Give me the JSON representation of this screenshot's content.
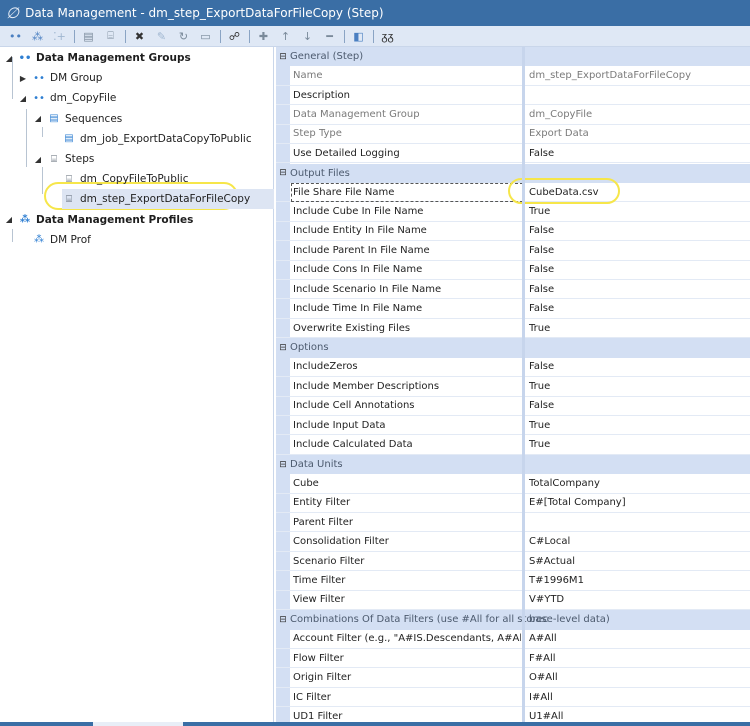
{
  "window": {
    "title": "Data Management - dm_step_ExportDataForFileCopy (Step)",
    "logo_glyph": "∅"
  },
  "toolbar": {
    "buttons": [
      {
        "name": "groups-icon",
        "glyph": "••"
      },
      {
        "name": "profiles-icon",
        "glyph": "⁂"
      },
      {
        "name": "add-group-icon",
        "glyph": "⁚+"
      },
      {
        "name": "sequence-icon",
        "glyph": "▤"
      },
      {
        "name": "step-icon",
        "glyph": "⌸"
      },
      {
        "name": "delete-icon",
        "glyph": "✖"
      },
      {
        "name": "edit-icon",
        "glyph": "✎"
      },
      {
        "name": "refresh-icon",
        "glyph": "↻"
      },
      {
        "name": "save-icon",
        "glyph": "▭"
      },
      {
        "name": "search-icon",
        "glyph": "☍"
      },
      {
        "name": "add-icon",
        "glyph": "✚"
      },
      {
        "name": "move-up-icon",
        "glyph": "↑"
      },
      {
        "name": "move-down-icon",
        "glyph": "↓"
      },
      {
        "name": "remove-icon",
        "glyph": "━"
      },
      {
        "name": "open-icon",
        "glyph": "◧"
      },
      {
        "name": "view-icon",
        "glyph": "ᵹᵹ"
      }
    ]
  },
  "tree": {
    "items": [
      {
        "label": "Data Management Groups",
        "icon": "••",
        "expander": "◢",
        "bold": true
      },
      {
        "label": "DM Group",
        "icon": "••",
        "expander": "▶",
        "bold": false
      },
      {
        "label": "dm_CopyFile",
        "icon": "••",
        "expander": "◢",
        "bold": false
      },
      {
        "label": "Sequences",
        "icon": "▤",
        "expander": "◢",
        "bold": false
      },
      {
        "label": "dm_job_ExportDataCopyToPublic",
        "icon": "▤",
        "expander": "",
        "bold": false
      },
      {
        "label": "Steps",
        "icon": "⌸",
        "expander": "◢",
        "bold": false
      },
      {
        "label": "dm_CopyFileToPublic",
        "icon": "⌸",
        "expander": "",
        "bold": false
      },
      {
        "label": "dm_step_ExportDataForFileCopy",
        "icon": "⌸",
        "expander": "",
        "bold": false,
        "selected": true
      },
      {
        "label": "Data Management Profiles",
        "icon": "⁂",
        "expander": "◢",
        "bold": true
      },
      {
        "label": "DM Prof",
        "icon": "⁂",
        "expander": "",
        "bold": false
      }
    ]
  },
  "properties": {
    "collapse_glyph": "⊟",
    "categories": [
      {
        "label": "General (Step)",
        "rows": [
          {
            "label": "Name",
            "value": "dm_step_ExportDataForFileCopy",
            "readonly": true
          },
          {
            "label": "Description",
            "value": "",
            "readonly": false
          },
          {
            "label": "Data Management Group",
            "value": "dm_CopyFile",
            "readonly": true
          },
          {
            "label": "Step Type",
            "value": "Export Data",
            "readonly": true
          },
          {
            "label": "Use Detailed Logging",
            "value": "False",
            "readonly": false
          }
        ]
      },
      {
        "label": "Output Files",
        "rows": [
          {
            "label": "File Share File Name",
            "value": "CubeData.csv",
            "readonly": false,
            "focused": true
          },
          {
            "label": "Include Cube In File Name",
            "value": "True",
            "readonly": false
          },
          {
            "label": "Include Entity In File Name",
            "value": "False",
            "readonly": false
          },
          {
            "label": "Include Parent In File Name",
            "value": "False",
            "readonly": false
          },
          {
            "label": "Include Cons In File Name",
            "value": "False",
            "readonly": false
          },
          {
            "label": "Include Scenario In File Name",
            "value": "False",
            "readonly": false
          },
          {
            "label": "Include Time In File Name",
            "value": "False",
            "readonly": false
          },
          {
            "label": "Overwrite Existing Files",
            "value": "True",
            "readonly": false
          }
        ]
      },
      {
        "label": "Options",
        "rows": [
          {
            "label": "IncludeZeros",
            "value": "False",
            "readonly": false
          },
          {
            "label": "Include Member Descriptions",
            "value": "True",
            "readonly": false
          },
          {
            "label": "Include Cell Annotations",
            "value": "False",
            "readonly": false
          },
          {
            "label": "Include Input Data",
            "value": "True",
            "readonly": false
          },
          {
            "label": "Include Calculated Data",
            "value": "True",
            "readonly": false
          }
        ]
      },
      {
        "label": "Data Units",
        "rows": [
          {
            "label": "Cube",
            "value": "TotalCompany",
            "readonly": false
          },
          {
            "label": "Entity Filter",
            "value": "E#[Total Company]",
            "readonly": false
          },
          {
            "label": "Parent Filter",
            "value": "",
            "readonly": false
          },
          {
            "label": "Consolidation Filter",
            "value": "C#Local",
            "readonly": false
          },
          {
            "label": "Scenario Filter",
            "value": "S#Actual",
            "readonly": false
          },
          {
            "label": "Time Filter",
            "value": "T#1996M1",
            "readonly": false
          },
          {
            "label": "View Filter",
            "value": "V#YTD",
            "readonly": false
          }
        ]
      },
      {
        "label": "Combinations Of Data Filters (use #All for all storec",
        "label_overflow": "base-level data)",
        "rows": [
          {
            "label": "Account Filter (e.g., \"A#IS.Descendants, A#All\")",
            "value": "A#All",
            "readonly": false
          },
          {
            "label": "Flow Filter",
            "value": "F#All",
            "readonly": false
          },
          {
            "label": "Origin Filter",
            "value": "O#All",
            "readonly": false
          },
          {
            "label": "IC Filter",
            "value": "I#All",
            "readonly": false
          },
          {
            "label": "UD1 Filter",
            "value": "U1#All",
            "readonly": false
          }
        ]
      }
    ]
  }
}
